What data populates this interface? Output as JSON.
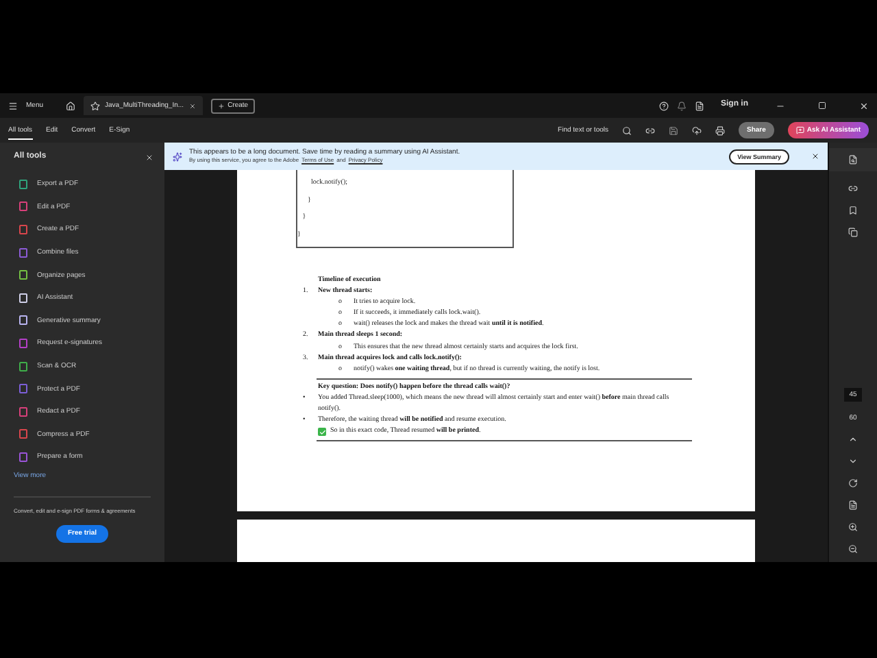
{
  "title_bar": {
    "menu": "Menu",
    "tab": "Java_MultiThreading_In...",
    "create": "Create",
    "sign_in": "Sign in"
  },
  "toolbar": {
    "tabs": [
      {
        "label": "All tools",
        "selected": true
      },
      {
        "label": "Edit",
        "selected": false
      },
      {
        "label": "Convert",
        "selected": false
      },
      {
        "label": "E-Sign",
        "selected": false
      }
    ],
    "search": "Find text or tools",
    "share": "Share",
    "ask": "Ask AI Assistant"
  },
  "sidebar": {
    "title": "All tools",
    "items": [
      {
        "label": "Export a PDF",
        "color": "#2fa37c"
      },
      {
        "label": "Edit a PDF",
        "color": "#d8407a"
      },
      {
        "label": "Create a PDF",
        "color": "#d9464c"
      },
      {
        "label": "Combine files",
        "color": "#8c5bd6"
      },
      {
        "label": "Organize pages",
        "color": "#74c043"
      },
      {
        "label": "AI Assistant",
        "color": "#cfcfe8"
      },
      {
        "label": "Generative summary",
        "color": "#b9b4f0"
      },
      {
        "label": "Request e-signatures",
        "color": "#b43fc8"
      },
      {
        "label": "Scan & OCR",
        "color": "#3fae4a"
      },
      {
        "label": "Protect a PDF",
        "color": "#7c5fd8"
      },
      {
        "label": "Redact a PDF",
        "color": "#d8407a"
      },
      {
        "label": "Compress a PDF",
        "color": "#d9464c"
      },
      {
        "label": "Prepare a form",
        "color": "#9a54d8"
      }
    ],
    "view_more": "View more",
    "promo": "Convert, edit and e-sign PDF forms & agreements",
    "free_trial": "Free trial"
  },
  "banner": {
    "text": "This appears to be a long document. Save time by reading a summary using AI Assistant.",
    "sub_before": "By using this service, you agree to the Adobe",
    "terms": "Terms of Use",
    "and": "and",
    "privacy": "Privacy Policy",
    "button": "View Summary"
  },
  "document": {
    "code_lines": [
      "        lock.notify();",
      "      }",
      "   }",
      "}"
    ],
    "heading": "Timeline of execution",
    "steps": [
      {
        "number": "1.",
        "title": "New thread starts:",
        "children": [
          {
            "marker": "o",
            "text": "It tries to acquire lock."
          },
          {
            "marker": "o",
            "text": "If it succeeds, it immediately calls lock.wait()."
          },
          {
            "marker": "o",
            "text": "wait() releases the lock and makes the thread wait **until it is notified**."
          }
        ]
      },
      {
        "number": "2.",
        "title": "Main thread sleeps 1 second:",
        "children": [
          {
            "marker": "o",
            "text": "This ensures that the new thread almost certainly starts and acquires the lock first."
          }
        ]
      },
      {
        "number": "3.",
        "title": "Main thread acquires lock and calls lock.notify():",
        "children": [
          {
            "marker": "o",
            "text": "notify() wakes **one waiting thread**, but if no thread is currently waiting, the notify is lost."
          }
        ]
      }
    ],
    "question": "Key question: Does notify() happen before the thread calls wait()?",
    "bullets": [
      {
        "marker": "•",
        "text": "You added Thread.sleep(1000), which means the new thread will almost certainly start and enter wait() **before** main thread calls notify()."
      },
      {
        "marker": "•",
        "text": "Therefore, the waiting thread **will be notified** and resume execution."
      }
    ],
    "conclusion": "So in this exact code, Thread resumed **will be printed**."
  },
  "right_rail": {
    "page": "45",
    "total": "60"
  }
}
